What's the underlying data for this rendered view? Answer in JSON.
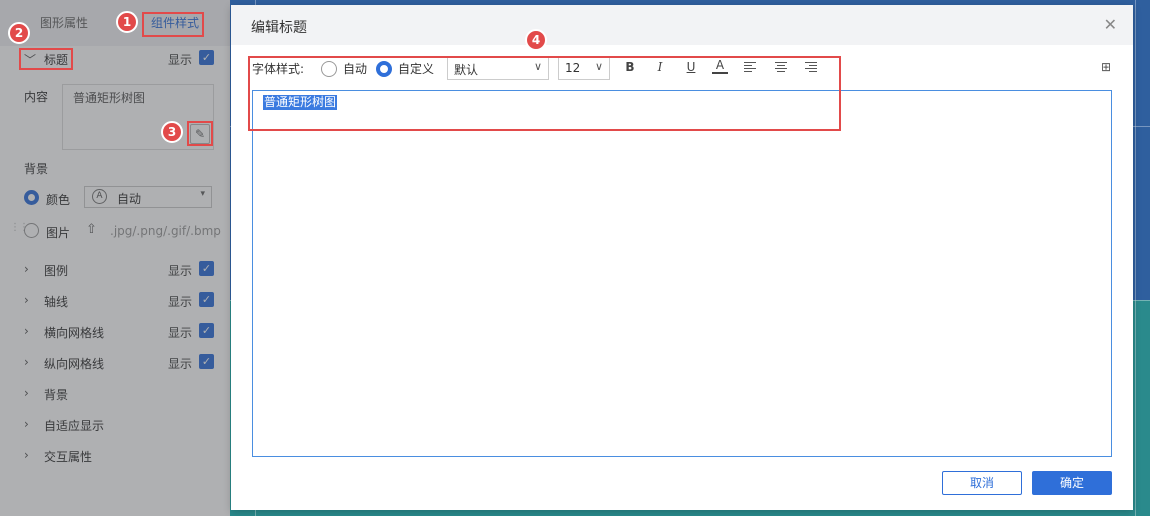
{
  "panel": {
    "tabs": [
      "图形属性",
      "组件样式"
    ],
    "title_section": {
      "label": "标题",
      "show": "显示"
    },
    "content_label": "内容",
    "content_value": "普通矩形树图",
    "background": {
      "label": "背景",
      "color_option": "颜色",
      "color_value": "自动",
      "image_option": "图片",
      "image_types": ".jpg/.png/.gif/.bmp"
    },
    "sections": [
      {
        "label": "图例",
        "show": "显示"
      },
      {
        "label": "轴线",
        "show": "显示"
      },
      {
        "label": "横向网格线",
        "show": "显示"
      },
      {
        "label": "纵向网格线",
        "show": "显示"
      },
      {
        "label": "背景"
      },
      {
        "label": "自适应显示"
      },
      {
        "label": "交互属性"
      }
    ]
  },
  "annotations": [
    "1",
    "2",
    "3",
    "4"
  ],
  "dialog": {
    "title": "编辑标题",
    "font_style_label": "字体样式:",
    "auto_option": "自动",
    "custom_option": "自定义",
    "font_family": "默认",
    "font_size": "12",
    "format_icons": [
      "B",
      "I",
      "U",
      "A"
    ],
    "editor_text": "普通矩形树图",
    "cancel": "取消",
    "ok": "确定"
  }
}
